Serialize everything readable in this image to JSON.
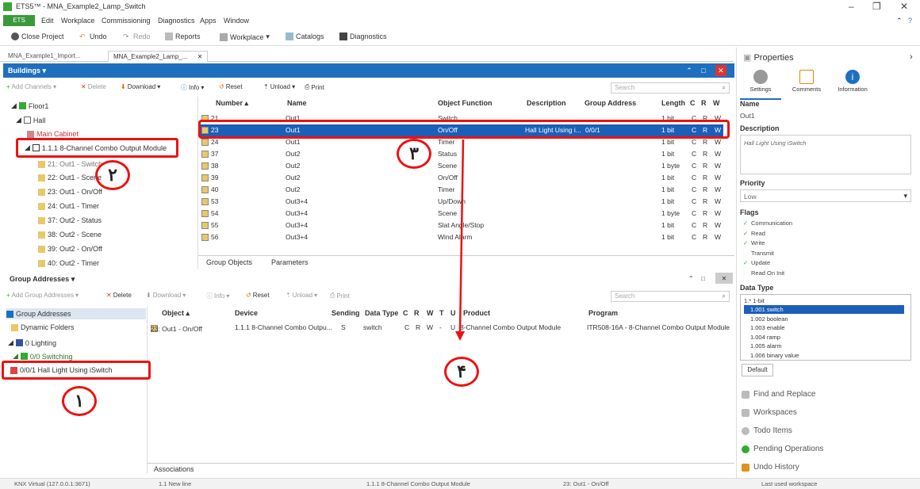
{
  "window": {
    "title": "ETS5™ - MNA_Example2_Lamp_Switch",
    "minimize": "–",
    "maximize": "❐",
    "close": "✕"
  },
  "menu": {
    "ets": "ETS",
    "items": [
      "Edit",
      "Workplace",
      "Commissioning",
      "Diagnostics",
      "Apps",
      "Window"
    ]
  },
  "toolbar": {
    "close_project": "Close Project",
    "undo": "Undo",
    "redo": "Redo",
    "reports": "Reports",
    "workplace": "Workplace",
    "catalogs": "Catalogs",
    "diagnostics": "Diagnostics"
  },
  "doc_tabs": [
    "MNA_Example1_Import...",
    "MNA_Example2_Lamp_..."
  ],
  "buildings": {
    "title": "Buildings",
    "tools": {
      "add_channels": "Add Channels",
      "delete": "Delete",
      "download": "Download",
      "info": "Info",
      "reset": "Reset",
      "unload": "Unload",
      "print": "Print",
      "search": "Search"
    },
    "tree": [
      {
        "label": "Floor1"
      },
      {
        "label": "Hall"
      },
      {
        "label": "Main Cabinet"
      },
      {
        "label": "1.1.1 8-Channel Combo Output Module"
      },
      {
        "label": "21: Out1 - Switch"
      },
      {
        "label": "22: Out1 - Scene"
      },
      {
        "label": "23: Out1 - On/Off"
      },
      {
        "label": "24: Out1 - Timer"
      },
      {
        "label": "37: Out2 - Status"
      },
      {
        "label": "38: Out2 - Scene"
      },
      {
        "label": "39: Out2 - On/Off"
      },
      {
        "label": "40: Out2 - Timer"
      }
    ],
    "columns": [
      "Number",
      "Name",
      "Object Function",
      "Description",
      "Group Address",
      "Length",
      "C",
      "R",
      "W"
    ],
    "rows": [
      {
        "num": "21",
        "name": "Out1",
        "func": "Switch",
        "desc": "",
        "ga": "",
        "len": "1 bit",
        "c": "C",
        "r": "R",
        "w": "W"
      },
      {
        "num": "23",
        "name": "Out1",
        "func": "On/Off",
        "desc": "Hall Light Using i...",
        "ga": "0/0/1",
        "len": "1 bit",
        "c": "C",
        "r": "R",
        "w": "W"
      },
      {
        "num": "24",
        "name": "Out1",
        "func": "Timer",
        "desc": "",
        "ga": "",
        "len": "1 bit",
        "c": "C",
        "r": "R",
        "w": "W"
      },
      {
        "num": "37",
        "name": "Out2",
        "func": "Status",
        "desc": "",
        "ga": "",
        "len": "1 bit",
        "c": "C",
        "r": "R",
        "w": "W"
      },
      {
        "num": "38",
        "name": "Out2",
        "func": "Scene",
        "desc": "",
        "ga": "",
        "len": "1 byte",
        "c": "C",
        "r": "R",
        "w": "W"
      },
      {
        "num": "39",
        "name": "Out2",
        "func": "On/Off",
        "desc": "",
        "ga": "",
        "len": "1 bit",
        "c": "C",
        "r": "R",
        "w": "W"
      },
      {
        "num": "40",
        "name": "Out2",
        "func": "Timer",
        "desc": "",
        "ga": "",
        "len": "1 bit",
        "c": "C",
        "r": "R",
        "w": "W"
      },
      {
        "num": "53",
        "name": "Out3+4",
        "func": "Up/Down",
        "desc": "",
        "ga": "",
        "len": "1 bit",
        "c": "C",
        "r": "R",
        "w": "W"
      },
      {
        "num": "54",
        "name": "Out3+4",
        "func": "Scene",
        "desc": "",
        "ga": "",
        "len": "1 byte",
        "c": "C",
        "r": "R",
        "w": "W"
      },
      {
        "num": "55",
        "name": "Out3+4",
        "func": "Slat Angle/Stop",
        "desc": "",
        "ga": "",
        "len": "1 bit",
        "c": "C",
        "r": "R",
        "w": "W"
      },
      {
        "num": "56",
        "name": "Out3+4",
        "func": "Wind Alarm",
        "desc": "",
        "ga": "",
        "len": "1 bit",
        "c": "C",
        "r": "R",
        "w": "W"
      }
    ],
    "tabs": [
      "Group Objects",
      "Parameters"
    ]
  },
  "group_addresses": {
    "title": "Group Addresses",
    "tools": {
      "add": "Add Group Addresses",
      "delete": "Delete",
      "download": "Download",
      "info": "Info",
      "reset": "Reset",
      "unload": "Unload",
      "print": "Print",
      "search": "Search"
    },
    "tree": [
      {
        "label": "Group Addresses"
      },
      {
        "label": "Dynamic Folders"
      },
      {
        "label": "0 Lighting"
      },
      {
        "label": "0/0 Switching"
      },
      {
        "label": "0/0/1 Hall Light Using iSwitch"
      }
    ],
    "columns": [
      "Object",
      "Device",
      "Sending",
      "Data Type",
      "C",
      "R",
      "W",
      "T",
      "U",
      "Product",
      "Program"
    ],
    "rows": [
      {
        "object": "23: Out1 - On/Off",
        "device": "1.1.1 8-Channel Combo Outpu...",
        "sending": "S",
        "dtype": "switch",
        "c": "C",
        "r": "R",
        "w": "W",
        "t": "-",
        "u": "U",
        "product": "8-Channel Combo Output Module",
        "program": "ITR508-16A - 8-Channel Combo Output Module"
      }
    ],
    "tabs": [
      "Associations"
    ]
  },
  "status_bar": {
    "connection": "KNX Virtual (127.0.0.1:3671)",
    "newline": "1.1 New line",
    "device": "1.1.1 8-Channel Combo Output Module",
    "object": "23: Out1 - On/Off",
    "workspace": "Last used workspace"
  },
  "properties": {
    "title": "Properties",
    "tabs": [
      "Settings",
      "Comments",
      "Information"
    ],
    "name_label": "Name",
    "name_value": "Out1",
    "desc_label": "Description",
    "desc_value": "Hall Light Using iSwitch",
    "priority_label": "Priority",
    "priority_value": "Low",
    "flags_label": "Flags",
    "flags": [
      {
        "label": "Communication",
        "check": "✓"
      },
      {
        "label": "Read",
        "check": "✓"
      },
      {
        "label": "Write",
        "check": "✓"
      },
      {
        "label": "Transmit",
        "check": ""
      },
      {
        "label": "Update",
        "check": "✓"
      },
      {
        "label": "Read On Init",
        "check": ""
      }
    ],
    "datatype_label": "Data Type",
    "datatype_group": "1.* 1-bit",
    "datatypes": [
      "1.001 switch",
      "1.002 boolean",
      "1.003 enable",
      "1.004 ramp",
      "1.005 alarm",
      "1.006 binary value"
    ],
    "default_btn": "Default",
    "links": [
      "Find and Replace",
      "Workspaces",
      "Todo Items",
      "Pending Operations",
      "Undo History"
    ]
  },
  "annotations": {
    "one": "١",
    "two": "٢",
    "three": "٣",
    "four": "۴"
  },
  "colors": {
    "accent": "#1f6fbf",
    "highlight": "#e11111",
    "selection": "#1c5fb8"
  }
}
